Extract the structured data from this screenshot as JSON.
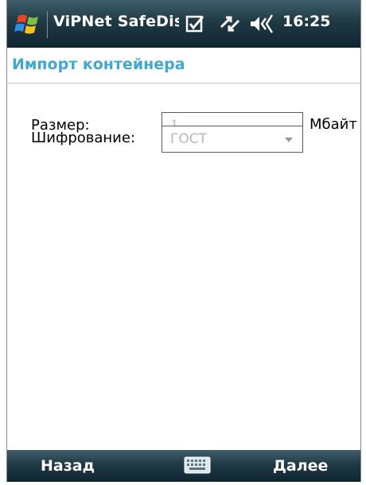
{
  "statusbar": {
    "app_title": "ViPNet SafeDisk",
    "time": "16:25",
    "icons": [
      "windows-start-icon",
      "notification-icon",
      "connectivity-icon",
      "volume-icon"
    ]
  },
  "header": {
    "title": "Импорт контейнера"
  },
  "form": {
    "size_label": "Размер:",
    "size_value": "1",
    "size_unit": "Мбайт",
    "encryption_label": "Шифрование:",
    "encryption_value": "ГОСТ"
  },
  "softkeys": {
    "left": "Назад",
    "right": "Далее"
  },
  "colors": {
    "header_text": "#3fa8cf",
    "bar_top": "#3f5e6a",
    "bar_bottom": "#0f2631"
  }
}
